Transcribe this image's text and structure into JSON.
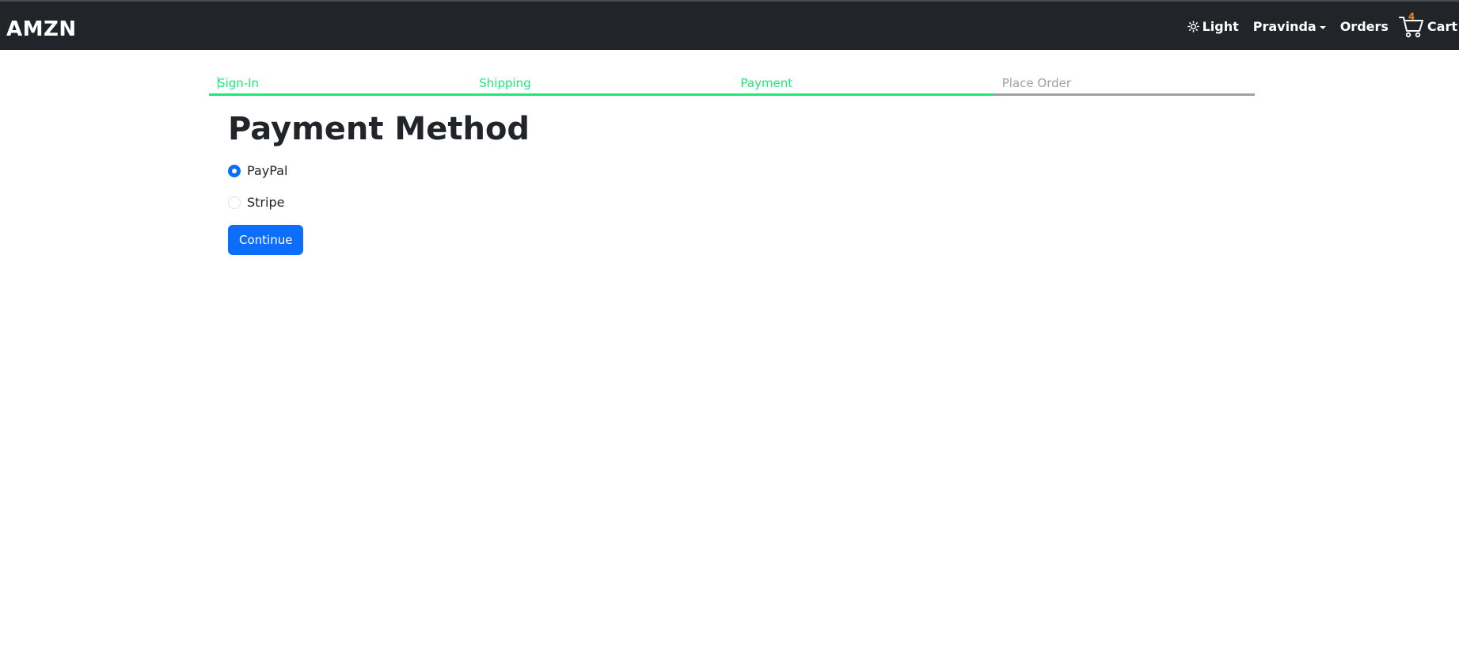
{
  "navbar": {
    "brand": "AMZN",
    "theme_label": "Light",
    "user_name": "Pravinda",
    "orders_label": "Orders",
    "cart_label": "Cart",
    "cart_count": "4"
  },
  "checkout_steps": [
    {
      "label": "Sign-In",
      "active": true
    },
    {
      "label": "Shipping",
      "active": true
    },
    {
      "label": "Payment",
      "active": true
    },
    {
      "label": "Place Order",
      "active": false
    }
  ],
  "payment": {
    "title": "Payment Method",
    "options": [
      {
        "label": "PayPal",
        "checked": true
      },
      {
        "label": "Stripe",
        "checked": false
      }
    ],
    "continue_label": "Continue"
  },
  "colors": {
    "navbar_bg": "#212529",
    "step_active": "#1ee87a",
    "step_inactive": "#a0a0a0",
    "primary": "#0d6efd",
    "cart_badge": "#fd7e14"
  }
}
